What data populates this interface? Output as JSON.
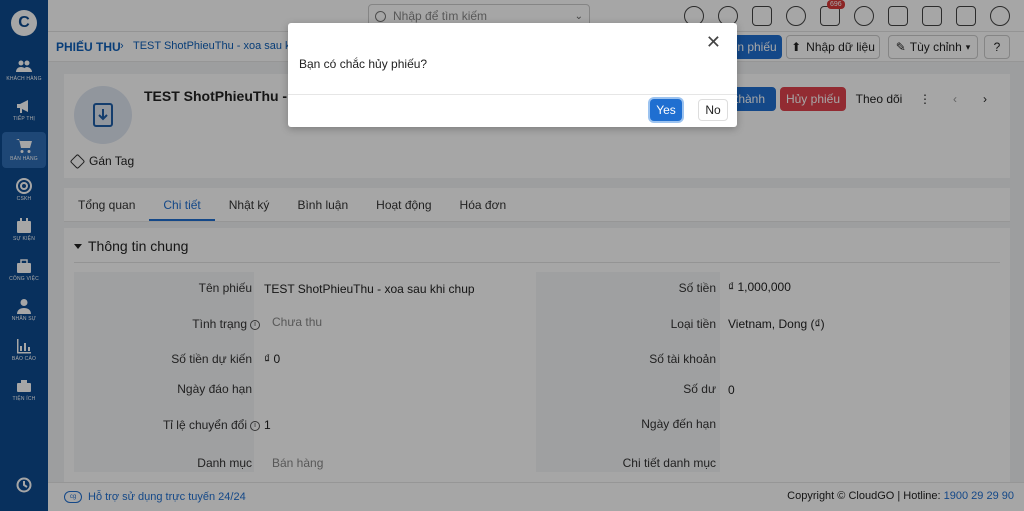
{
  "sidebar": {
    "logo": "C",
    "items": [
      {
        "label": "Khách hàng"
      },
      {
        "label": "Tiếp thị"
      },
      {
        "label": "Bán hàng"
      },
      {
        "label": "CSKH"
      },
      {
        "label": "Sự kiện"
      },
      {
        "label": "Công việc"
      },
      {
        "label": "Nhân sự"
      },
      {
        "label": "Báo cáo"
      },
      {
        "label": "Tiện ích"
      }
    ],
    "active_item": "Bán hàng"
  },
  "topbar": {
    "search_placeholder": "Nhập để tìm kiếm",
    "notification_count": "696"
  },
  "breadcrumb": {
    "module": "PHIẾU THU",
    "separator": "›",
    "record": "TEST ShotPhieuThu - xoa sau khi"
  },
  "actions": {
    "partial_left": "n phiếu",
    "import": "Nhập dữ liệu",
    "customize": "Tùy chỉnh",
    "partial_complete": "thành",
    "cancel_voucher": "Hủy phiếu",
    "follow": "Theo dõi"
  },
  "record": {
    "title": "TEST ShotPhieuThu - x",
    "tag_label": "Gán Tag"
  },
  "tabs": [
    "Tổng quan",
    "Chi tiết",
    "Nhật ký",
    "Bình luận",
    "Hoạt động",
    "Hóa đơn"
  ],
  "active_tab": "Chi tiết",
  "section": {
    "title": "Thông tin chung",
    "left_fields": [
      {
        "label": "Tên phiếu",
        "value": "TEST ShotPhieuThu - xoa sau khi chup"
      },
      {
        "label": "Tình trạng",
        "value": "Chưa thu"
      },
      {
        "label": "Số tiền dự kiến",
        "value": "₫ 0"
      },
      {
        "label": "Ngày đáo hạn",
        "value": ""
      },
      {
        "label": "Tỉ lệ chuyển đổi",
        "value": "1"
      },
      {
        "label": "Danh mục",
        "value": "Bán hàng"
      }
    ],
    "right_fields": [
      {
        "label": "Số tiền",
        "value": "₫ 1,000,000"
      },
      {
        "label": "Loại tiền",
        "value": "Vietnam, Dong (₫)"
      },
      {
        "label": "Số tài khoản",
        "value": ""
      },
      {
        "label": "Số dư",
        "value": "0"
      },
      {
        "label": "Ngày đến hạn",
        "value": ""
      },
      {
        "label": "Chi tiết danh mục",
        "value": ""
      }
    ]
  },
  "footer": {
    "support_text": "Hỗ trợ sử dụng trực tuyến 24/24",
    "copyright": "Copyright © CloudGO | Hotline: ",
    "hotline": "1900 29 29 90"
  },
  "modal": {
    "message": "Bạn có chắc hủy phiếu?",
    "yes_label": "Yes",
    "no_label": "No",
    "close_glyph": "✕"
  },
  "colors": {
    "sidebar": "#0d4a8f",
    "primary": "#1f6fd1",
    "danger": "#e0434e"
  }
}
